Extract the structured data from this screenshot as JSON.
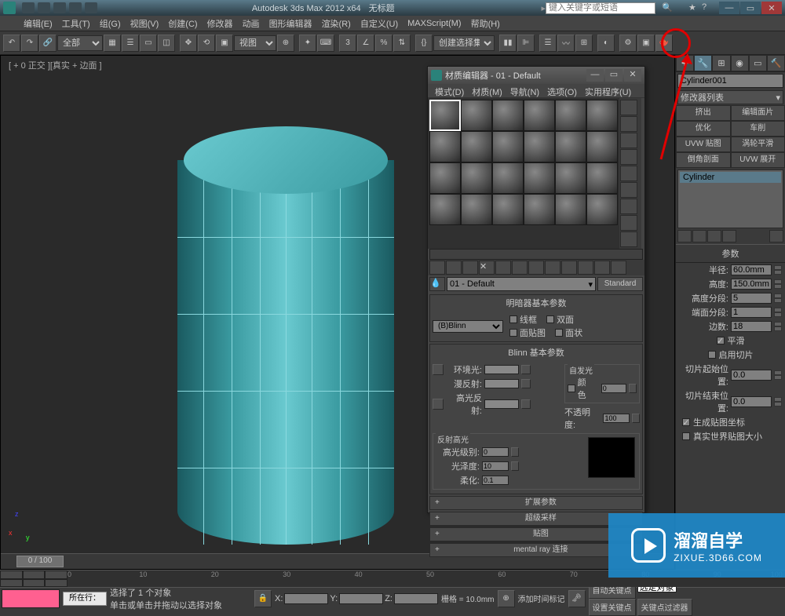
{
  "titlebar": {
    "app_title": "Autodesk 3ds Max  2012 x64",
    "doc_title": "无标题",
    "search_placeholder": "键入关键字或短语"
  },
  "win": {
    "min": "—",
    "max": "▭",
    "close": "✕"
  },
  "menu": [
    "编辑(E)",
    "工具(T)",
    "组(G)",
    "视图(V)",
    "创建(C)",
    "修改器",
    "动画",
    "图形编辑器",
    "渲染(R)",
    "自定义(U)",
    "MAXScript(M)",
    "帮助(H)"
  ],
  "toolbar": {
    "scope_label": "全部",
    "view_label": "视图",
    "selset_label": "创建选择集"
  },
  "viewport": {
    "label": "[ + 0 正交 ][真实 + 边面 ]"
  },
  "time": {
    "slider": "0 / 100"
  },
  "cmd_panel": {
    "object_name": "Cylinder001",
    "mod_list_label": "修改器列表",
    "mod_buttons": [
      [
        "挤出",
        "编辑面片"
      ],
      [
        "优化",
        "车削"
      ],
      [
        "UVW 贴图",
        "涡轮平滑"
      ],
      [
        "倒角剖面",
        "UVW 展开"
      ]
    ],
    "stack_item": "Cylinder",
    "rollout_title": "参数",
    "params": {
      "radius_lbl": "半径:",
      "radius": "60.0mm",
      "height_lbl": "高度:",
      "height": "150.0mm",
      "hseg_lbl": "高度分段:",
      "hseg": "5",
      "cseg_lbl": "端面分段:",
      "cseg": "1",
      "sides_lbl": "边数:",
      "sides": "18"
    },
    "chk_smooth": "平滑",
    "chk_slice": "启用切片",
    "slice_from_lbl": "切片起始位置:",
    "slice_from": "0.0",
    "slice_to_lbl": "切片结束位置:",
    "slice_to": "0.0",
    "chk_genuv": "生成贴图坐标",
    "chk_realuv": "真实世界贴图大小"
  },
  "mat_editor": {
    "title": "材质编辑器 - 01 - Default",
    "menu": [
      "模式(D)",
      "材质(M)",
      "导航(N)",
      "选项(O)",
      "实用程序(U)"
    ],
    "mat_name": "01 - Default",
    "mat_type": "Standard",
    "rollout_shader": "明暗器基本参数",
    "shader_name": "(B)Blinn",
    "chk_wire": "线框",
    "chk_2side": "双面",
    "chk_facemap": "面贴图",
    "chk_faceted": "面状",
    "rollout_blinn": "Blinn 基本参数",
    "self_illum": "自发光",
    "chk_color": "颜色",
    "self_val": "0",
    "ambient": "环境光:",
    "diffuse": "漫反射:",
    "specular": "高光反射:",
    "opacity_lbl": "不透明度:",
    "opacity": "100",
    "spec_hl": "反射高光",
    "spec_level_lbl": "高光级别:",
    "spec_level": "0",
    "gloss_lbl": "光泽度:",
    "gloss": "10",
    "soften_lbl": "柔化:",
    "soften": "0.1",
    "rollouts_collapsed": [
      "扩展参数",
      "超级采样",
      "贴图",
      "mental ray 连接"
    ]
  },
  "status": {
    "sel_text": "选择了 1 个对象",
    "hint": "单击或单击并拖动以选择对象",
    "row_label": "所在行：",
    "x": "X:",
    "y": "Y:",
    "z": "Z:",
    "grid": "栅格 = 10.0mm",
    "add_time": "添加时间标记",
    "autokey": "自动关键点",
    "selset": "选定对象",
    "setkey": "设置关键点",
    "keyfilter": "关键点过滤器"
  },
  "watermark": {
    "big": "溜溜自学",
    "small": "ZIXUE.3D66.COM"
  }
}
